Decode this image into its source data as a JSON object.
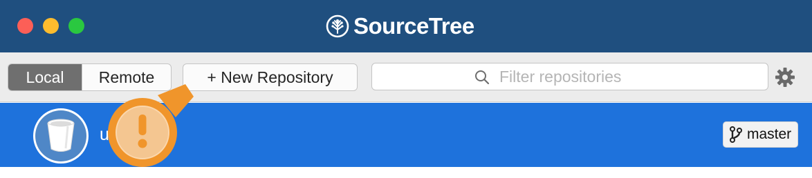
{
  "window": {
    "app_title": "SourceTree",
    "traffic_lights": {
      "close_color": "#fc5f57",
      "minimize_color": "#fdbc2e",
      "maximize_color": "#2ac840"
    },
    "title_bar_color": "#1f4f7f"
  },
  "toolbar": {
    "tabs": [
      {
        "label": "Local",
        "selected": true
      },
      {
        "label": "Remote",
        "selected": false
      }
    ],
    "new_repo_label": "+ New Repository",
    "search": {
      "placeholder": "Filter repositories",
      "value": "",
      "icon": "search-icon"
    },
    "settings_icon": "gear-icon"
  },
  "repositories": [
    {
      "name": "u         s",
      "icon": "bucket-icon",
      "branch": "master",
      "branch_icon": "branch-icon",
      "selected": true,
      "selection_color": "#1e72dc"
    }
  ],
  "callout": {
    "icon": "exclamation-icon",
    "color": "#f0952b",
    "symbol": "!"
  }
}
